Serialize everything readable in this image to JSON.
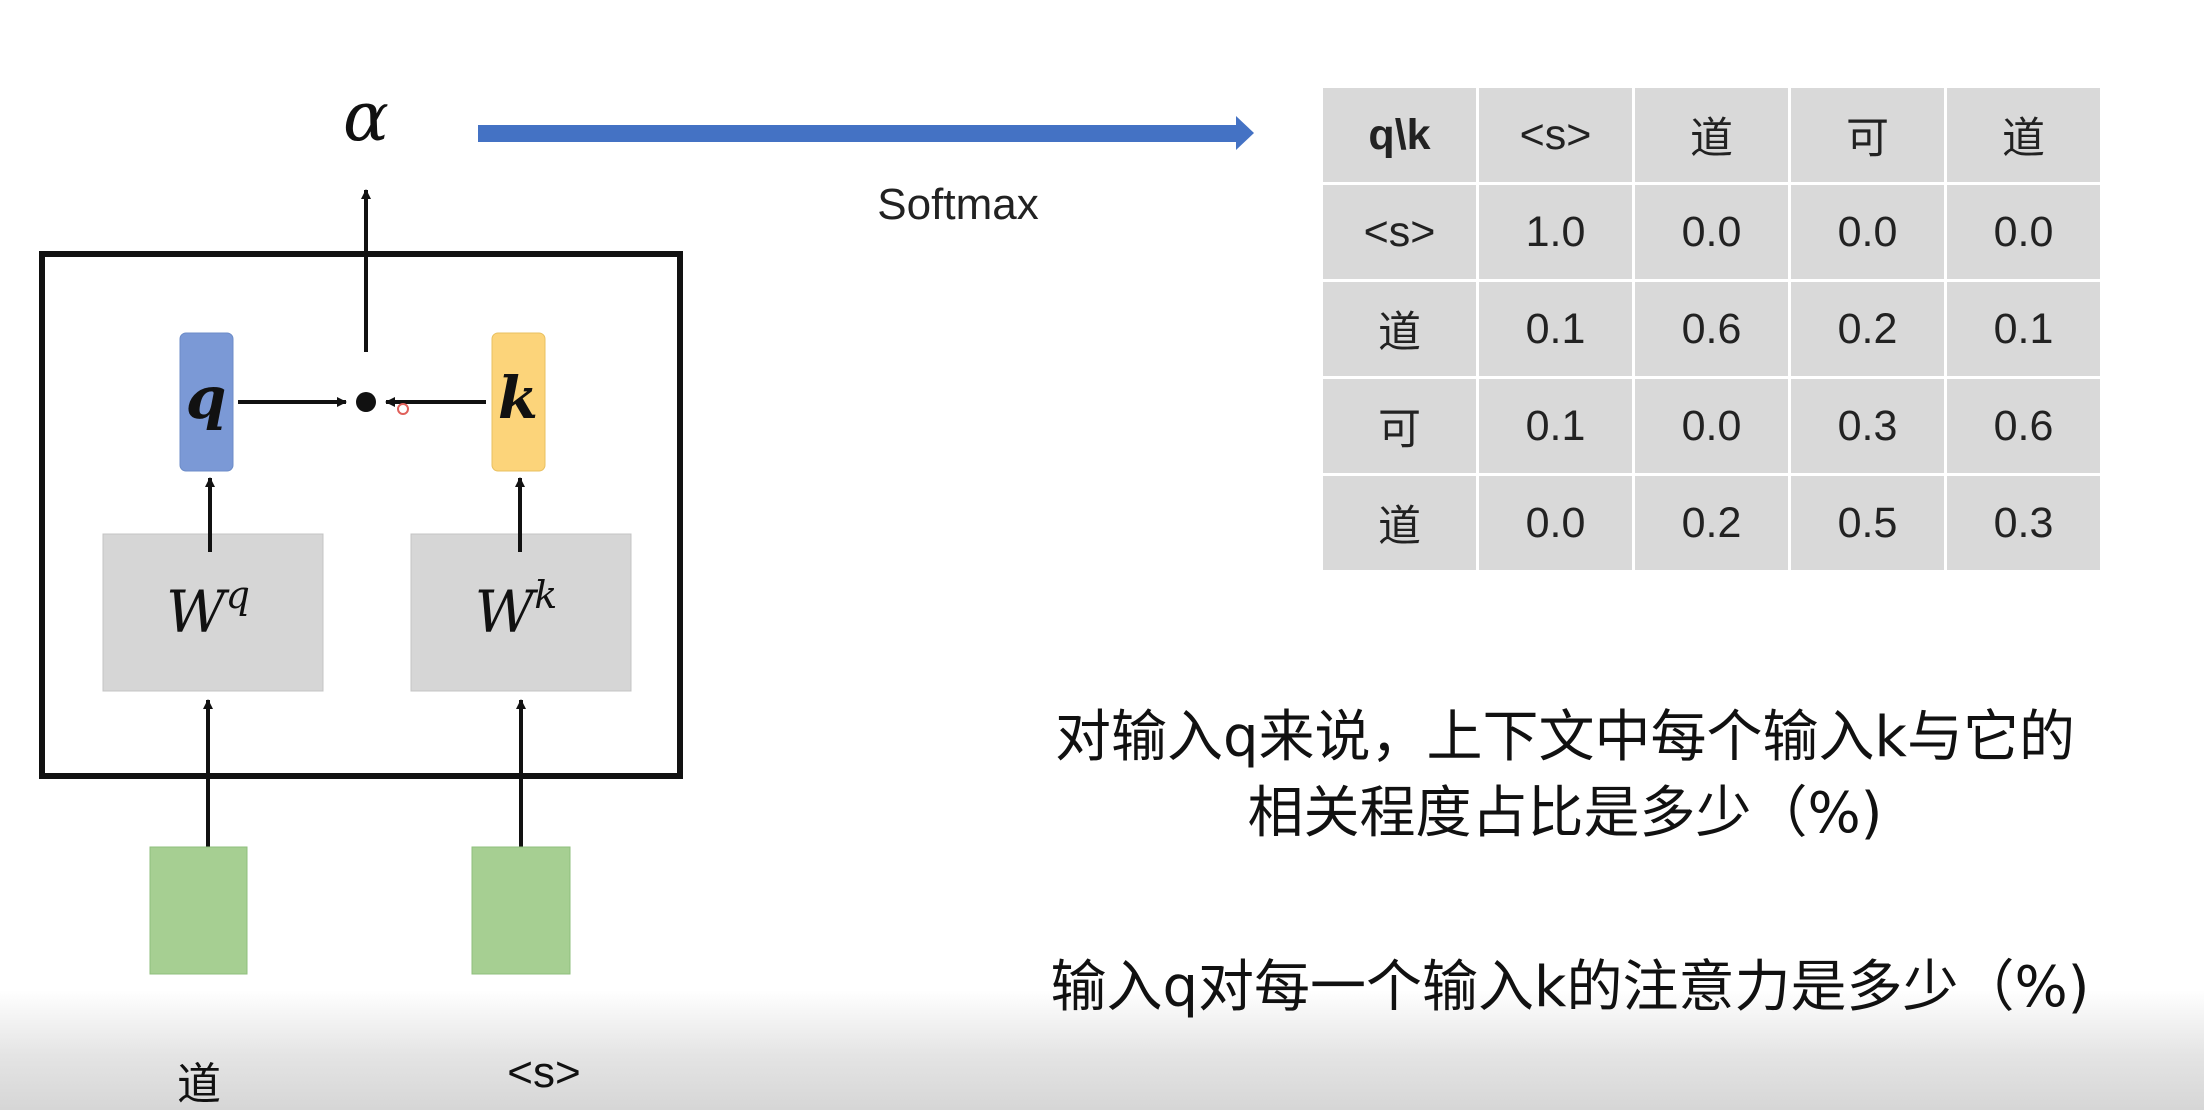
{
  "diagram": {
    "alpha_label": "α",
    "q_label": "q",
    "k_label": "k",
    "wq_base": "W",
    "wq_sup": "q",
    "wk_base": "W",
    "wk_sup": "k",
    "input_left_label": "道",
    "input_right_label": "<s>",
    "arrow_label": "Softmax",
    "colors": {
      "q_box": "#7b99d6",
      "k_box": "#fcd47a",
      "w_box": "#d6d6d6",
      "input_box": "#a6cf92",
      "arrow_blue": "#4472c4"
    }
  },
  "table": {
    "corner": "q\\k",
    "col_headers": [
      "<s>",
      "道",
      "可",
      "道"
    ],
    "rows": [
      {
        "label": "<s>",
        "values": [
          "1.0",
          "0.0",
          "0.0",
          "0.0"
        ]
      },
      {
        "label": "道",
        "values": [
          "0.1",
          "0.6",
          "0.2",
          "0.1"
        ]
      },
      {
        "label": "可",
        "values": [
          "0.1",
          "0.0",
          "0.3",
          "0.6"
        ]
      },
      {
        "label": "道",
        "values": [
          "0.0",
          "0.2",
          "0.5",
          "0.3"
        ]
      }
    ]
  },
  "captions": {
    "line1": "对输入q来说，上下文中每个输入k与它的",
    "line2": "相关程度占比是多少（%)",
    "line3": "输入q对每一个输入k的注意力是多少（%)"
  }
}
